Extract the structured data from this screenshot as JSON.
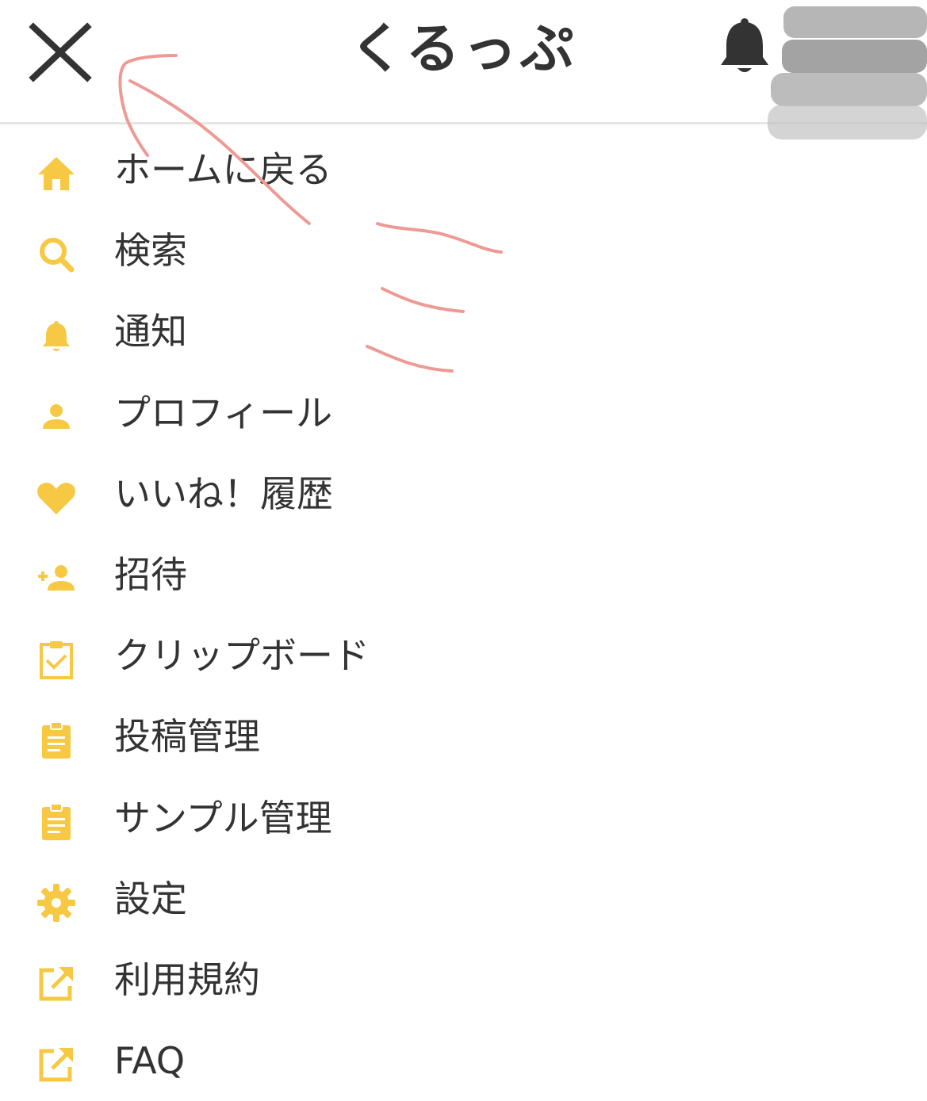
{
  "header": {
    "title": "くるっぷ",
    "close_icon": "close-icon",
    "bell_icon": "bell-icon"
  },
  "colors": {
    "accent": "#f6c843",
    "text": "#333333",
    "annotation": "#ee9a94"
  },
  "menu": {
    "items": [
      {
        "label": "ホームに戻る",
        "icon": "home-icon"
      },
      {
        "label": "検索",
        "icon": "search-icon"
      },
      {
        "label": "通知",
        "icon": "bell-icon"
      },
      {
        "label": "プロフィール",
        "icon": "person-icon"
      },
      {
        "label": "いいね！履歴",
        "icon": "heart-icon"
      },
      {
        "label": "招待",
        "icon": "person-add-icon"
      },
      {
        "label": "クリップボード",
        "icon": "clipboard-check-icon"
      },
      {
        "label": "投稿管理",
        "icon": "clipboard-icon"
      },
      {
        "label": "サンプル管理",
        "icon": "clipboard-icon"
      },
      {
        "label": "設定",
        "icon": "gear-icon"
      },
      {
        "label": "利用規約",
        "icon": "external-link-icon"
      },
      {
        "label": "FAQ",
        "icon": "external-link-icon"
      }
    ]
  }
}
